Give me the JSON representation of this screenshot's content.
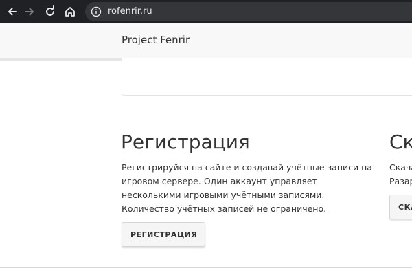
{
  "browser": {
    "url": "rofenrir.ru",
    "icons": [
      "back-icon",
      "forward-icon",
      "reload-icon",
      "home-icon",
      "info-icon"
    ],
    "colors": {
      "chrome_bg": "#202124",
      "omnibox_bg": "#35363a",
      "url_text": "#e8eaed"
    }
  },
  "navbar": {
    "brand": "Project Fenrir"
  },
  "sections": {
    "register": {
      "title": "Регистрация",
      "description_lines": [
        "Регистрируйся на сайте и создавай учётные записи на",
        "игровом сервере. Один аккаунт управляет",
        "несколькими игровыми учётными записями.",
        "Количество учётных записей не ограничено."
      ],
      "button_label": "Регистрация"
    },
    "download": {
      "title": "Скачать",
      "description_lines": [
        "Скачай клиент игры.",
        "Разархивируй и играй."
      ],
      "button_label": "Скачать"
    }
  }
}
